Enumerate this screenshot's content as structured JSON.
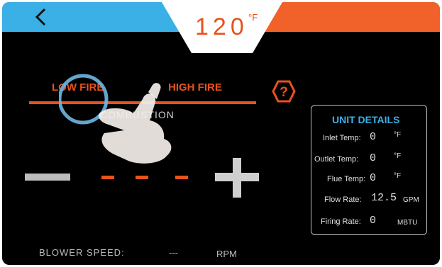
{
  "header": {
    "temperature": "120",
    "temperature_unit": "°F"
  },
  "tabs": {
    "low_fire": "LOW FIRE",
    "high_fire": "HIGH FIRE",
    "combustion": "COMBUSTION"
  },
  "unit_details": {
    "title": "UNIT DETAILS",
    "rows": [
      {
        "label": "Inlet Temp:",
        "value": "0",
        "unit": "°F"
      },
      {
        "label": "Outlet Temp:",
        "value": "0",
        "unit": "°F"
      },
      {
        "label": "Flue Temp:",
        "value": "0",
        "unit": "°F"
      },
      {
        "label": "Flow Rate:",
        "value": "12.5",
        "unit": "GPM"
      },
      {
        "label": "Firing Rate:",
        "value": "0",
        "unit": "MBTU"
      }
    ]
  },
  "blower": {
    "label": "BLOWER SPEED:",
    "value": "---",
    "unit": "RPM"
  },
  "colors": {
    "accent_orange": "#e8521c",
    "accent_blue": "#3ab0e6",
    "background": "#000000"
  },
  "icons": [
    "back-chevron-icon",
    "help-hexagon-icon",
    "minus-icon",
    "plus-icon",
    "pointing-hand-icon"
  ]
}
